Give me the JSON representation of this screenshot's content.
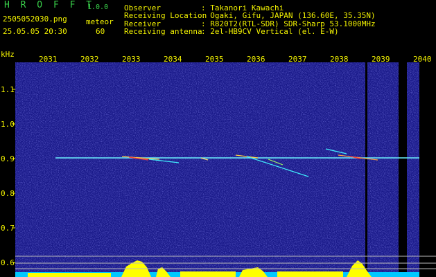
{
  "header": {
    "app_name": "H R O F F T",
    "version": "1.0.0",
    "filename": "2505052030.png",
    "timestamp": "25.05.05 20:30",
    "count_label": "meteor",
    "count_value": "60",
    "fields": [
      {
        "label": "Observer",
        "value": ": Takanori Kawachi"
      },
      {
        "label": "Receiving Location",
        "value": ": Ogaki, Gifu, JAPAN (136.60E, 35.35N)"
      },
      {
        "label": "Receiver",
        "value": ": R820T2(RTL-SDR) SDR-Sharp 53.1000MHz"
      },
      {
        "label": "Receiving antenna",
        "value": ": 2el-HB9CV Vertical (el. E-W)"
      }
    ]
  },
  "spectrogram": {
    "y_unit": "kHz",
    "y_ticks": [
      "1.1",
      "1.0",
      "0.9",
      "0.8",
      "0.7",
      "0.6"
    ],
    "x_ticks": [
      "2031",
      "2032",
      "2033",
      "2034",
      "2035",
      "2036",
      "2037",
      "2038",
      "2039",
      "2040"
    ],
    "carrier_khz": 0.9,
    "colors": {
      "background": "#1a1a8a",
      "axis_text": "#f2f200",
      "header_text": "#39d04a",
      "level_bar": "#ffff00",
      "level_floor": "#00c8ff"
    }
  }
}
